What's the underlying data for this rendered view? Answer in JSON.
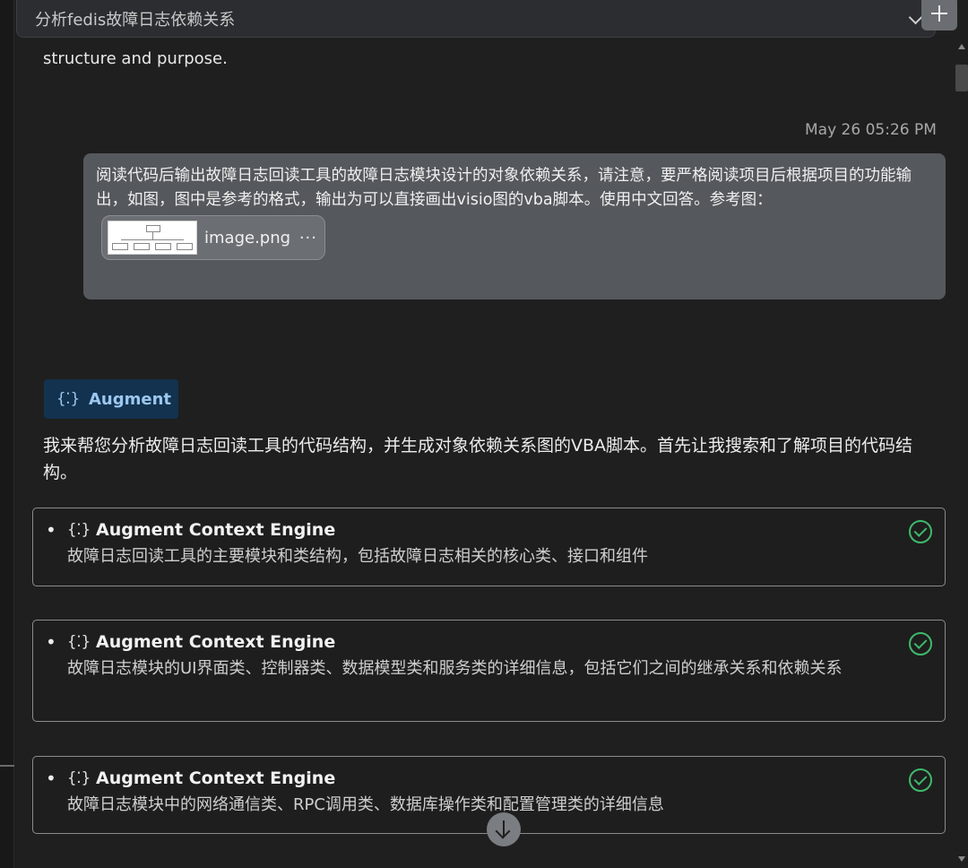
{
  "header": {
    "title": "分析fedis故障日志依赖关系"
  },
  "conversation": {
    "previous_fragment": "structure and purpose.",
    "timestamp": "May 26 05:26 PM",
    "user_message": "阅读代码后输出故障日志回读工具的故障日志模块设计的对象依赖关系，请注意，要严格阅读项目后根据项目的功能输出，如图，图中是参考的格式，输出为可以直接画出visio图的vba脚本。使用中文回答。参考图：",
    "attachment": {
      "filename": "image.png",
      "more": "···"
    },
    "assistant": {
      "badge": "Augment",
      "intro": "我来帮您分析故障日志回读工具的代码结构，并生成对象依赖关系图的VBA脚本。首先让我搜索和了解项目的代码结构。",
      "tools": [
        {
          "name": "Augment Context Engine",
          "description": "故障日志回读工具的主要模块和类结构，包括故障日志相关的核心类、接口和组件",
          "status": "success"
        },
        {
          "name": "Augment Context Engine",
          "description": "故障日志模块的UI界面类、控制器类、数据模型类和服务类的详细信息，包括它们之间的继承关系和依赖关系",
          "status": "success"
        },
        {
          "name": "Augment Context Engine",
          "description": "故障日志模块中的网络通信类、RPC调用类、数据库操作类和配置管理类的详细信息",
          "status": "success"
        }
      ]
    }
  },
  "icons": {
    "bot": "{⁚}",
    "bullet": "•"
  },
  "colors": {
    "background": "#1e1e1e",
    "user_bubble": "#55585c",
    "badge_bg": "#12324f",
    "badge_text": "#9cc7f0",
    "success": "#3fb96b"
  }
}
